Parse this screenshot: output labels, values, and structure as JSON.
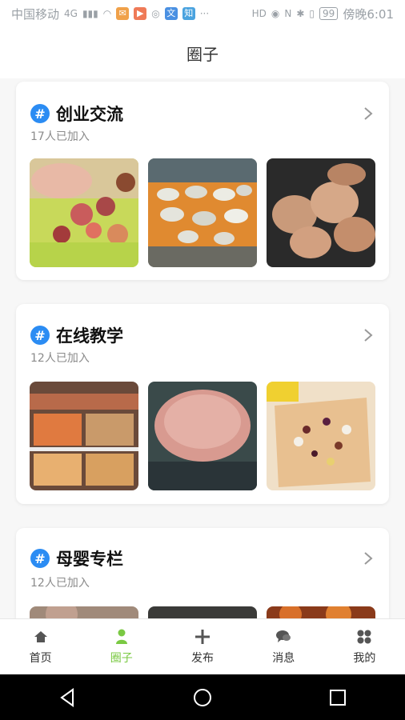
{
  "status_bar": {
    "carrier": "中国移动",
    "network": "4G",
    "battery": "99",
    "time": "傍晚6:01",
    "badges": [
      "HD",
      "N"
    ]
  },
  "header": {
    "title": "圈子"
  },
  "cards": [
    {
      "title": "创业交流",
      "members": "17人已加入",
      "thumbs": [
        "food-platter",
        "table-of-dishes",
        "meatballs"
      ]
    },
    {
      "title": "在线教学",
      "members": "12人已加入",
      "thumbs": [
        "deli-display",
        "seared-steak",
        "granola-toast"
      ]
    },
    {
      "title": "母婴专栏",
      "members": "12人已加入",
      "thumbs": [
        "photo-1",
        "photo-2",
        "photo-3"
      ]
    }
  ],
  "bottom_nav": [
    {
      "label": "首页",
      "icon": "home-icon",
      "active": false
    },
    {
      "label": "圈子",
      "icon": "person-icon",
      "active": true
    },
    {
      "label": "发布",
      "icon": "plus-icon",
      "active": false
    },
    {
      "label": "消息",
      "icon": "chat-icon",
      "active": false
    },
    {
      "label": "我的",
      "icon": "grid-icon",
      "active": false
    }
  ],
  "colors": {
    "accent": "#7ac943",
    "hash_badge": "#2b8cf3"
  }
}
